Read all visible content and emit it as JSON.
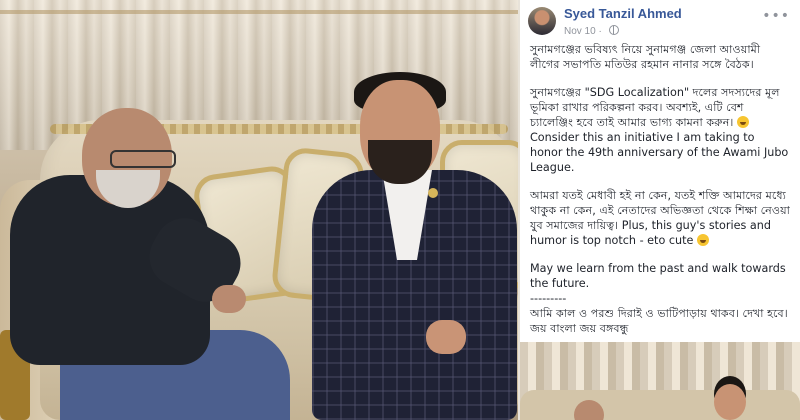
{
  "post": {
    "author": "Syed Tanzil Ahmed",
    "date": "Nov 10",
    "date_separator": "·",
    "more_label": "•••",
    "paragraphs": [
      "সুনামগঞ্জের ভবিষ্যৎ নিয়ে সুনামগঞ্জ জেলা আওয়ামী লীগের সভাপতি মতিউর রহমান নানার সঙ্গে বৈঠক।",
      "সুনামগঞ্জের \"SDG Localization\" দলের সদস্যদের মূল ভূমিকা রাখার পরিকল্পনা করব। অবশ্যই, এটি বেশ চ্যালেঞ্জিং হবে তাই আমার ভাগ্য কামনা করুন।",
      "Consider this an initiative I am taking to honor the 49th anniversary of the Awami Jubo League.",
      "আমরা যতই মেধাবী হই না কেন, যতই শক্তি আমাদের মধ্যে থাকুক না কেন, এই নেতাদের অভিজ্ঞতা থেকে শিক্ষা নেওয়া যুব সমাজের দায়িত্ব। Plus, this guy's stories and humor is top notch - eto cute",
      "May we learn from the past and walk towards the future."
    ],
    "divider": "---------",
    "closing_lines": [
      "আমি কাল ও পরশু দিরাই ও ভাটিপাড়ায় থাকব। দেখা হবে।",
      "জয় বাংলা জয় বঙ্গবন্ধু"
    ],
    "link_color": "#385898"
  },
  "icons": {
    "globe": "globe-icon",
    "more": "more-options-icon",
    "emoji": "laughing-emoji-icon"
  }
}
